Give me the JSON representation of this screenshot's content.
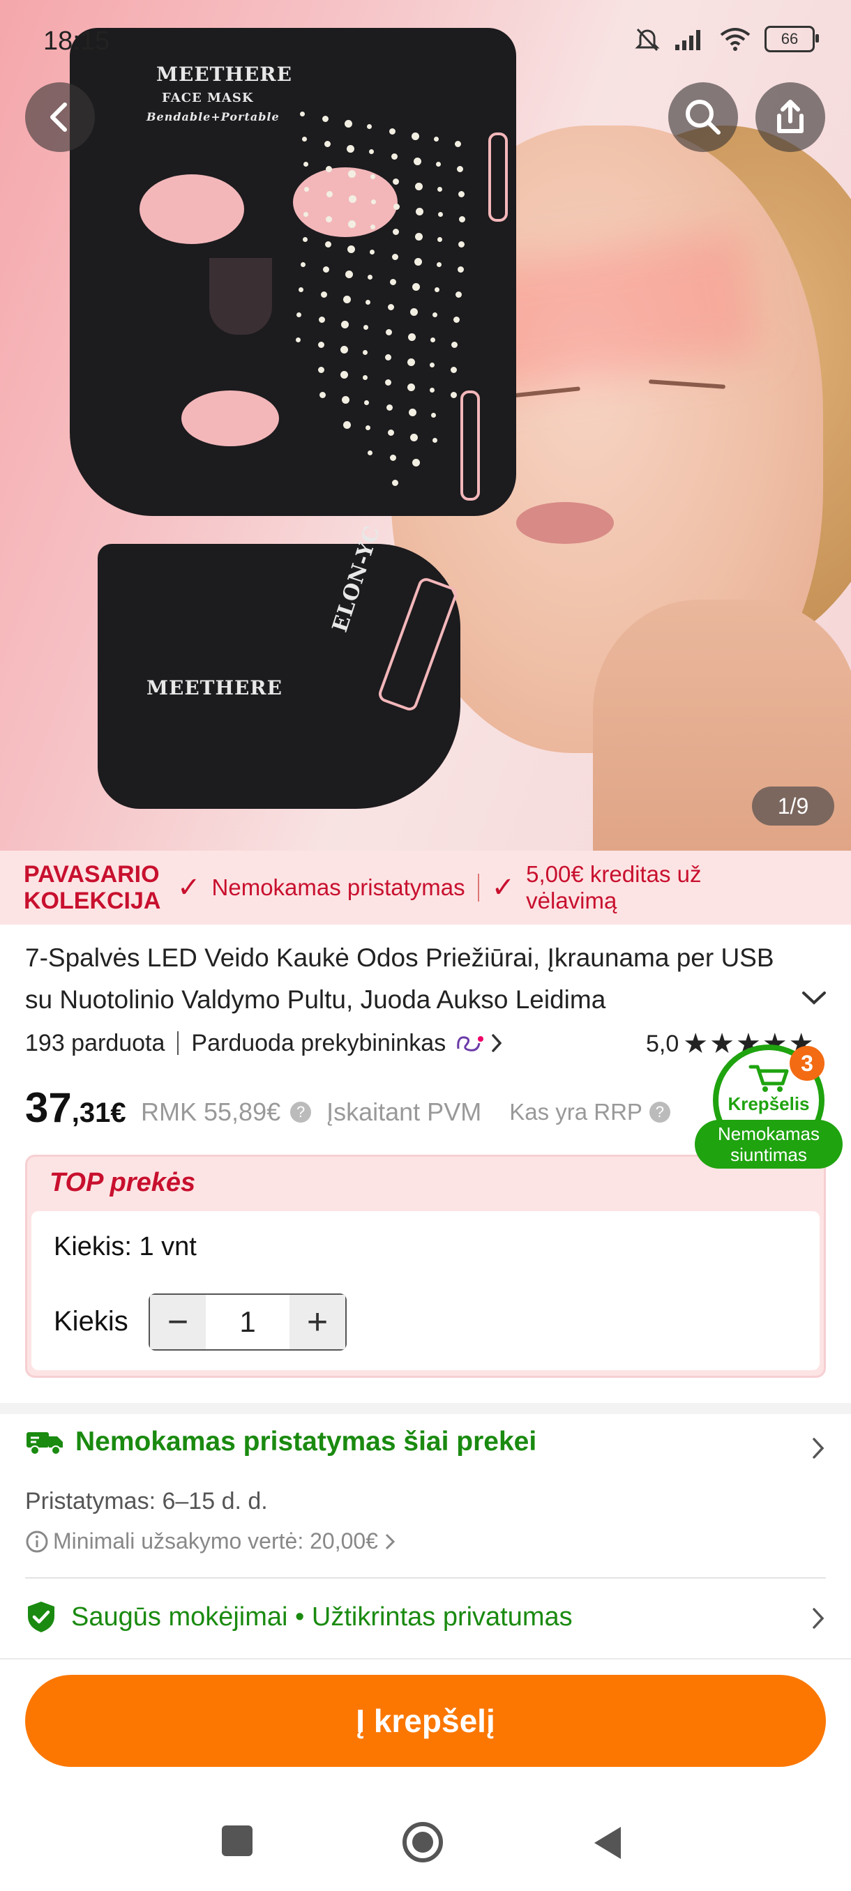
{
  "status_bar": {
    "time": "18:15",
    "battery": "66",
    "icons": [
      "bell-muted-icon",
      "signal-icon",
      "wifi-icon",
      "battery-icon"
    ]
  },
  "hero": {
    "counter": "1/9",
    "mask_brand": "MEETHERE",
    "mask_line1": "FACE MASK",
    "mask_line2": "Bendable+Portable",
    "chin_brand": "MEETHERE",
    "chin_side": "ELON-YC",
    "buttons": [
      "back-icon",
      "search-icon",
      "share-icon"
    ]
  },
  "promo": {
    "title_line1": "PAVASARIO",
    "title_line2": "KOLEKCIJA",
    "item1": "Nemokamas pristatymas",
    "item2_line1": "5,00€ kreditas už",
    "item2_line2": "vėlavimą"
  },
  "product": {
    "title": "7-Spalvės LED Veido Kaukė Odos Priežiūrai, Įkraunama per USB su Nuotolinio Valdymo Pultu, Juoda Aukso Leidima",
    "sold": "193 parduota",
    "seller": "Parduoda prekybininkas",
    "rating": "5,0",
    "rating_value": 5,
    "price_int": "37",
    "price_dec": ",31€",
    "rrp": "RMK 55,89€",
    "vat": "Įskaitant PVM",
    "what_rrp": "Kas yra RRP"
  },
  "cart_widget": {
    "count": "3",
    "label": "Krepšelis",
    "pill_line1": "Nemokamas",
    "pill_line2": "siuntimas"
  },
  "top_box": {
    "label": "TOP prekės",
    "quantity_info": "Kiekis: 1 vnt",
    "quantity_label": "Kiekis",
    "quantity_value": "1"
  },
  "shipping": {
    "title": "Nemokamas pristatymas šiai prekei",
    "delivery": "Pristatymas: 6–15 d. d.",
    "min_order": "Minimali užsakymo vertė: 20,00€"
  },
  "security": {
    "text": "Saugūs mokėjimai • Užtikrintas privatumas"
  },
  "cta": {
    "label": "Į krepšelį"
  },
  "colors": {
    "accent_orange": "#fb7701",
    "promo_red": "#c8102e",
    "green": "#1a8a10"
  }
}
